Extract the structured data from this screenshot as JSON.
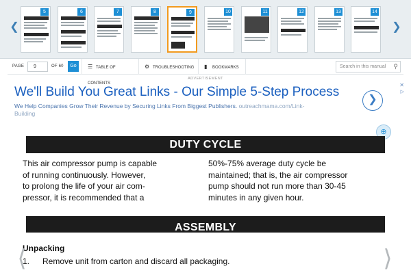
{
  "thumbnails": [
    {
      "page": "5"
    },
    {
      "page": "6"
    },
    {
      "page": "7"
    },
    {
      "page": "8"
    },
    {
      "page": "9"
    },
    {
      "page": "10"
    },
    {
      "page": "11"
    },
    {
      "page": "12"
    },
    {
      "page": "13"
    },
    {
      "page": "14"
    }
  ],
  "active_page": "9",
  "toolbar": {
    "page_label": "PAGE",
    "page_value": "9",
    "of_label": "OF 60",
    "go_label": "Go",
    "toc_label": "TABLE OF CONTENTS",
    "troubleshooting_label": "TROUBLESHOOTING",
    "bookmarks_label": "BOOKMARKS",
    "search_placeholder": "Search in this manual"
  },
  "ad": {
    "label": "ADVERTISEMENT",
    "title": "We'll Build You Great Links - Our Simple 5-Step Process",
    "description": "We Help Companies Grow Their Revenue by Securing Links From Biggest Publishers.",
    "source_line1": "outreachmama.com/Link-",
    "source_line2": "Building"
  },
  "manual": {
    "duty_cycle_heading": "DUTY CYCLE",
    "left_col": [
      "This air compressor pump is capable",
      "of running continuously. However,",
      "to prolong the life of your air com-",
      "pressor, it is recommended that a"
    ],
    "right_col": [
      "50%-75% average duty cycle be",
      "maintained; that is, the air compressor",
      "pump should not run more than 30-45",
      "minutes in any given hour."
    ],
    "assembly_heading": "ASSEMBLY",
    "unpacking_heading": "Unpacking",
    "step_number": "1.",
    "step_text": "Remove unit from carton and discard all packaging."
  },
  "icons": {
    "strip_prev": "chevron-left-icon",
    "strip_next": "chevron-right-icon",
    "toc": "list-icon",
    "troubleshooting": "gears-icon",
    "bookmarks": "bookmark-icon",
    "search": "search-icon",
    "zoom": "zoom-in-icon"
  },
  "colors": {
    "accent": "#1e8fd5",
    "active_thumb": "#f29a1e",
    "ad_title": "#1a5fbf",
    "heading_bar": "#1c1c1c"
  }
}
